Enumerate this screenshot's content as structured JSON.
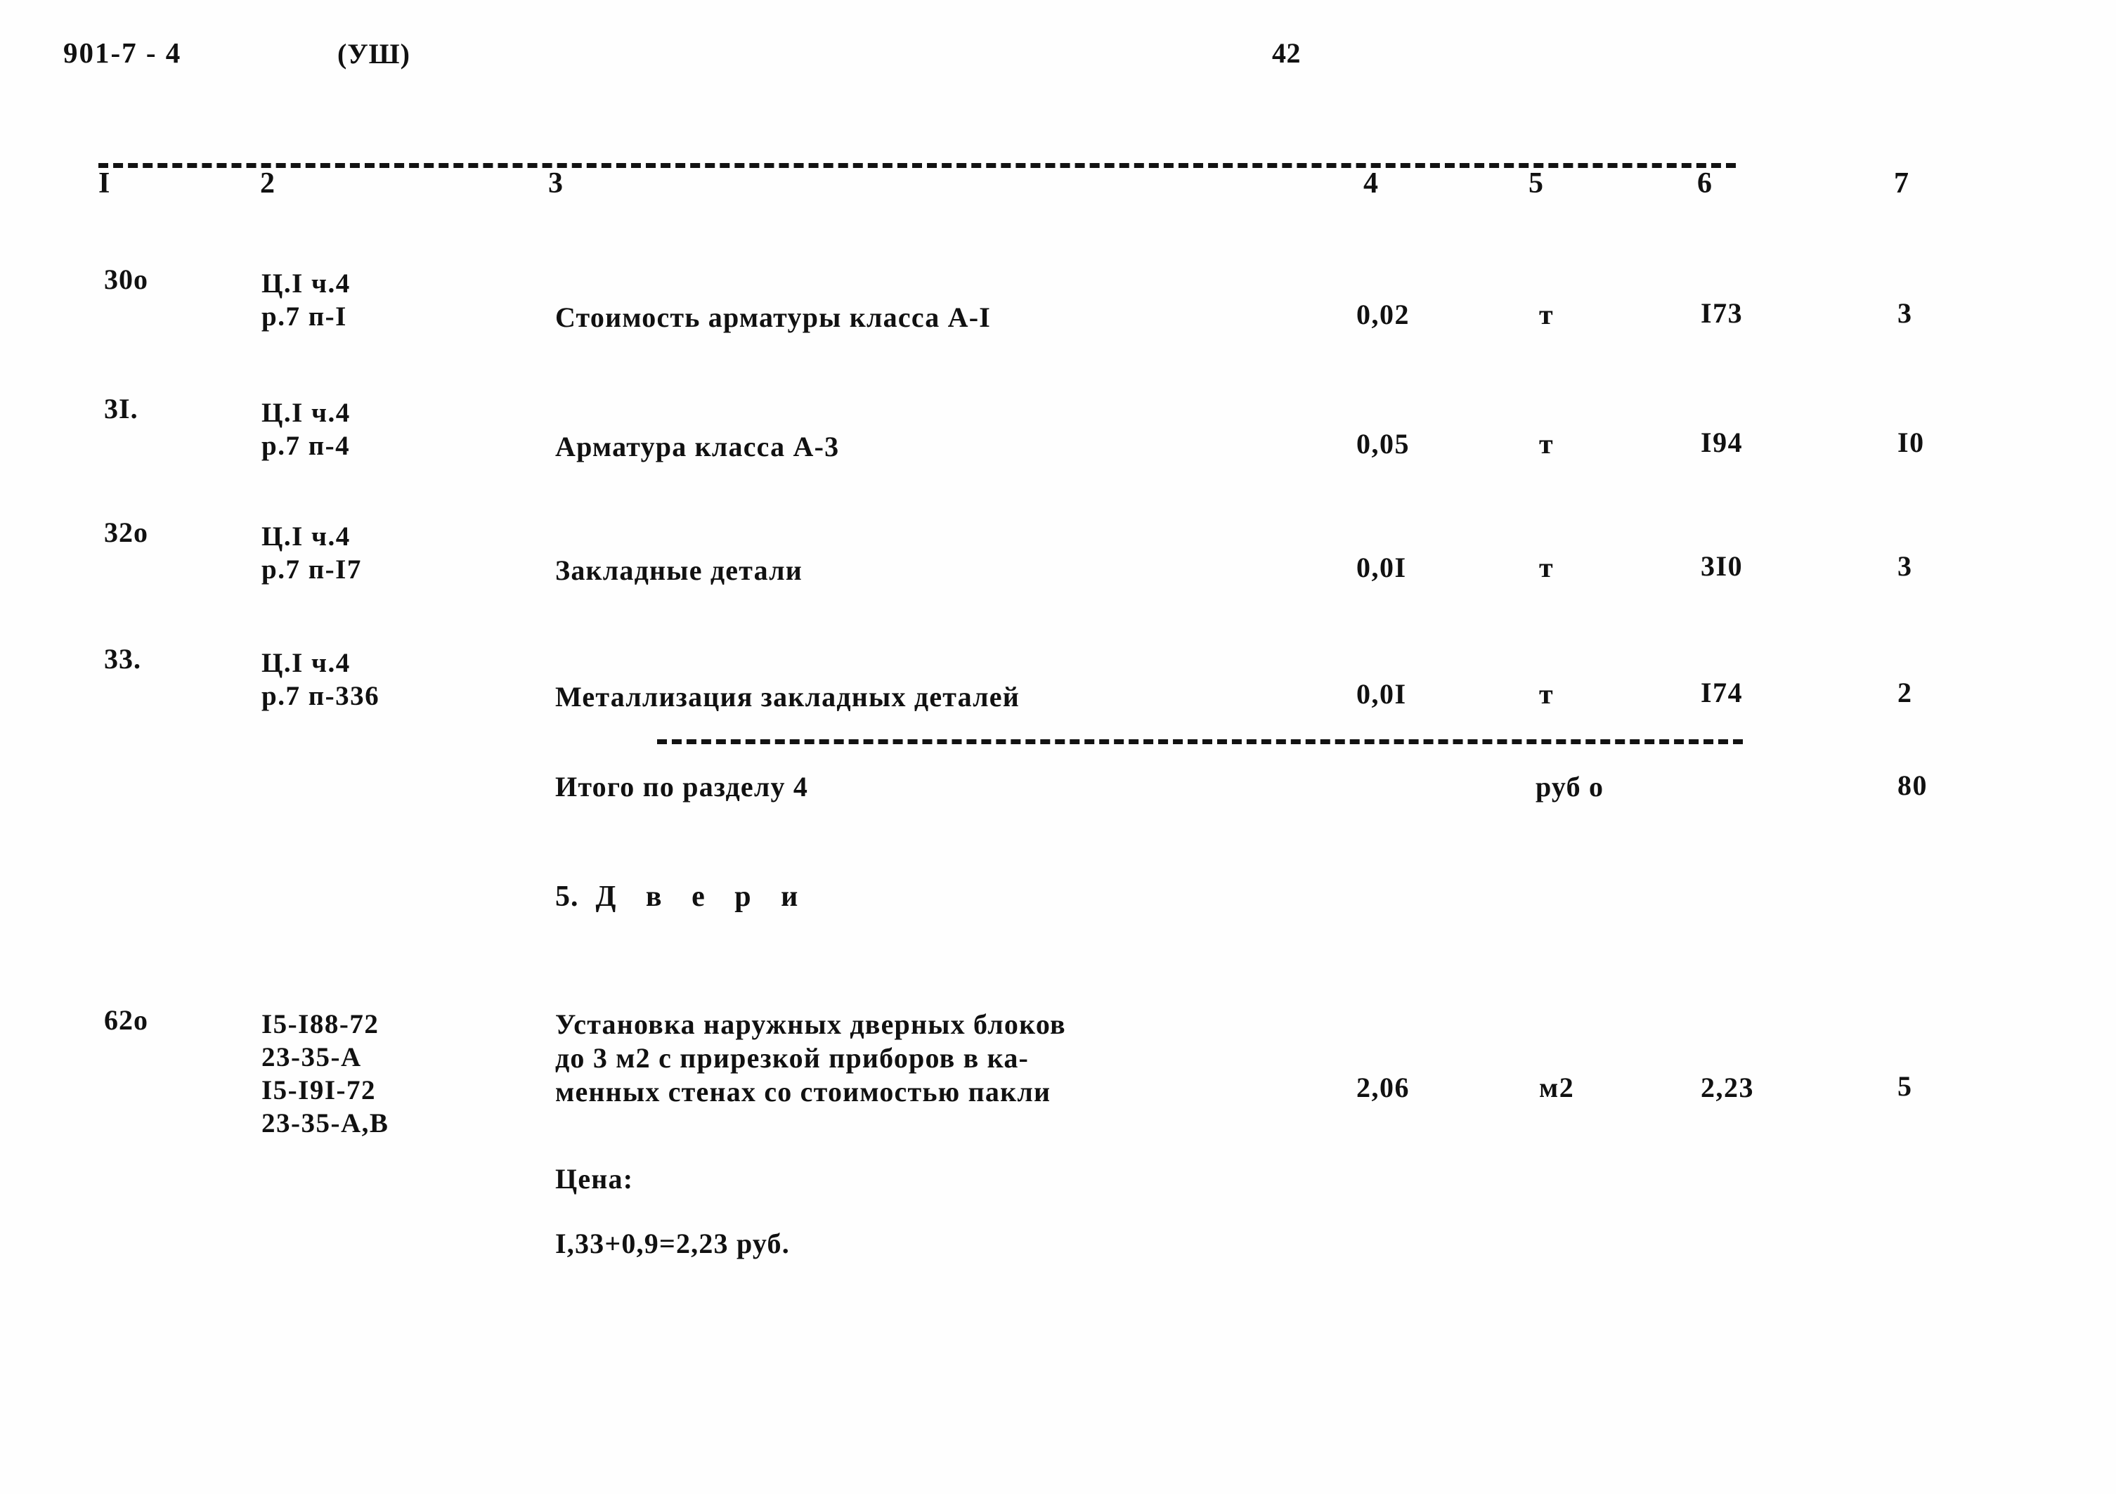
{
  "header": {
    "doc_code": "901-7 - 4",
    "series": "(УШ)",
    "page_number": "42"
  },
  "table": {
    "column_numbers": [
      "I",
      "2",
      "3",
      "4",
      "5",
      "6",
      "7"
    ],
    "rows": [
      {
        "num": "30о",
        "code_line1": "Ц.I ч.4",
        "code_line2": "р.7 п-I",
        "description_line1": "Стоимость арматуры класса А-I",
        "description_line2": "",
        "description_line3": "",
        "qty": "0,02",
        "unit": "т",
        "price": "I73",
        "total": "3"
      },
      {
        "num": "3I.",
        "code_line1": "Ц.I ч.4",
        "code_line2": "р.7 п-4",
        "description_line1": "Арматура класса А-3",
        "description_line2": "",
        "description_line3": "",
        "qty": "0,05",
        "unit": "т",
        "price": "I94",
        "total": "I0"
      },
      {
        "num": "32о",
        "code_line1": "Ц.I ч.4",
        "code_line2": "р.7 п-I7",
        "description_line1": "Закладные детали",
        "description_line2": "",
        "description_line3": "",
        "qty": "0,0I",
        "unit": "т",
        "price": "3I0",
        "total": "3"
      },
      {
        "num": "33.",
        "code_line1": "Ц.I ч.4",
        "code_line2": "р.7 п-336",
        "description_line1": "Металлизация закладных деталей",
        "description_line2": "",
        "description_line3": "",
        "qty": "0,0I",
        "unit": "т",
        "price": "I74",
        "total": "2"
      }
    ],
    "subtotal": {
      "label": "Итого по разделу 4",
      "unit": "руб о",
      "value": "80"
    },
    "section_heading": {
      "number": "5.",
      "title": "Д в е р и"
    },
    "doors_row": {
      "num": "62о",
      "code_line1": "I5-I88-72",
      "code_line2": "23-35-А",
      "code_line3": "I5-I9I-72",
      "code_line4": "23-35-А,В",
      "description_line1": "Установка наружных дверных блоков",
      "description_line2": "до 3 м2 с прирезкой приборов в ка-",
      "description_line3": "менных стенах со стоимостью пакли",
      "qty": "2,06",
      "unit": "м2",
      "price": "2,23",
      "total": "5"
    },
    "price_note": {
      "label": "Цена:",
      "formula": "I,33+0,9=2,23 руб."
    }
  }
}
